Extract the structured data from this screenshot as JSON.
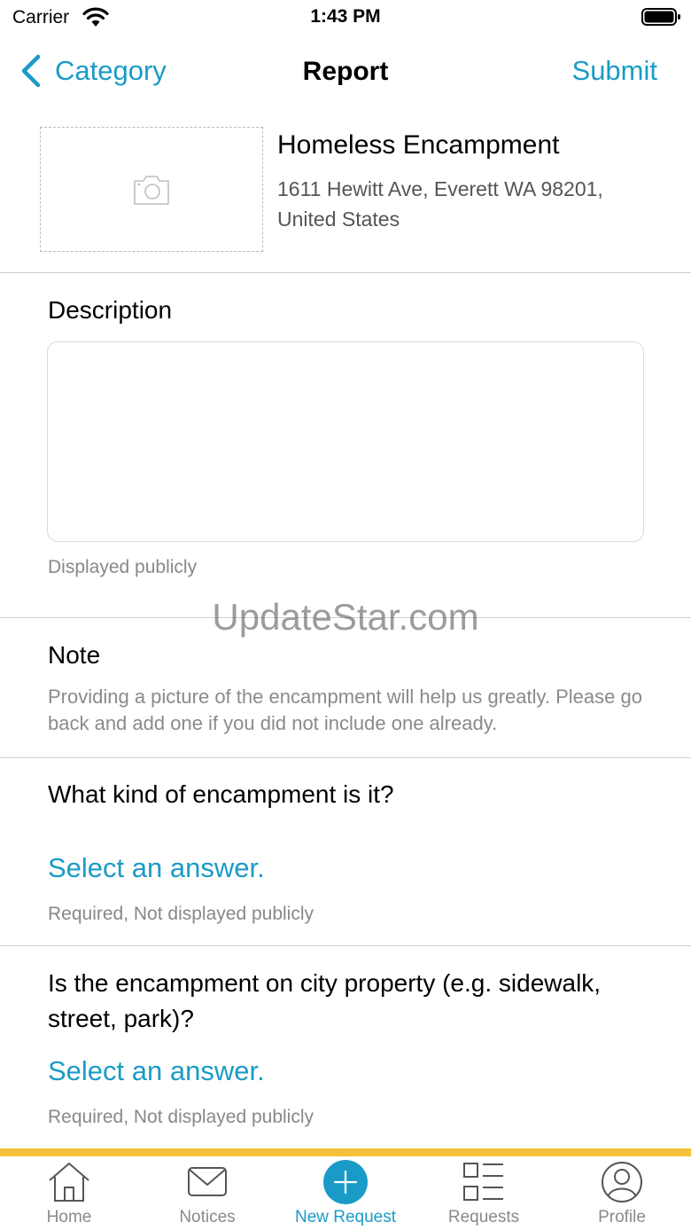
{
  "status_bar": {
    "carrier": "Carrier",
    "time": "1:43 PM"
  },
  "nav": {
    "back_label": "Category",
    "title": "Report",
    "submit_label": "Submit"
  },
  "header": {
    "category": "Homeless Encampment",
    "address": "1611 Hewitt Ave, Everett WA 98201, United States"
  },
  "description": {
    "label": "Description",
    "value": "",
    "hint": "Displayed publicly"
  },
  "watermark": "UpdateStar.com",
  "note": {
    "label": "Note",
    "text": "Providing a picture of the encampment will help us greatly. Please go back and add one if you did not include one already."
  },
  "questions": [
    {
      "text": "What kind of encampment is it?",
      "answer_placeholder": "Select an answer.",
      "hint": "Required, Not displayed publicly"
    },
    {
      "text": "Is the encampment on city property (e.g. sidewalk, street, park)?",
      "answer_placeholder": "Select an answer.",
      "hint": "Required, Not displayed publicly"
    }
  ],
  "tabs": [
    {
      "label": "Home",
      "icon": "home-icon"
    },
    {
      "label": "Notices",
      "icon": "envelope-icon"
    },
    {
      "label": "New Request",
      "icon": "plus-circle-icon",
      "active": true
    },
    {
      "label": "Requests",
      "icon": "list-icon"
    },
    {
      "label": "Profile",
      "icon": "person-circle-icon"
    }
  ],
  "colors": {
    "accent": "#1a9bc7",
    "tab_accent": "#f3c13a",
    "hint": "#888888"
  }
}
